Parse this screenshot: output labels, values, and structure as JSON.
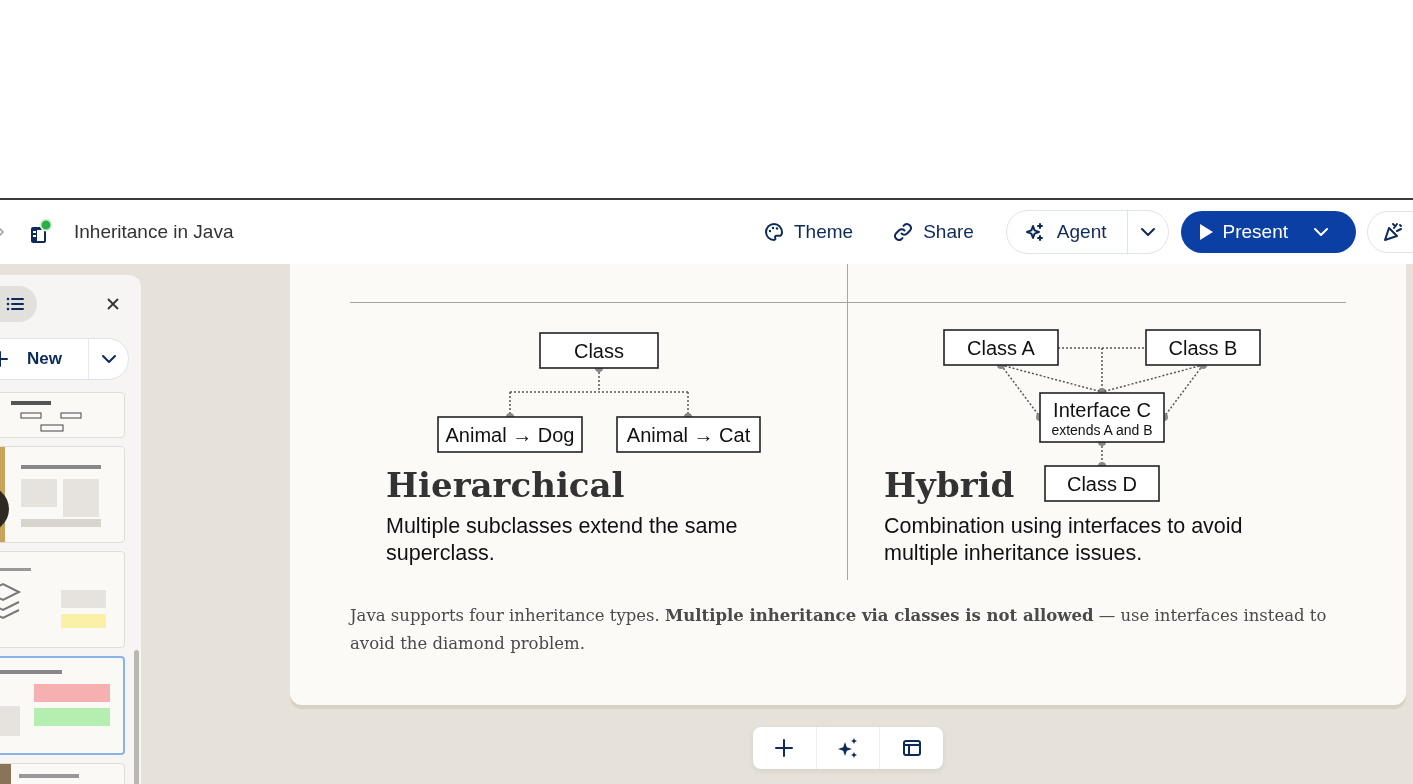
{
  "header": {
    "title": "Inheritance in Java",
    "actions": [
      {
        "kind": "theme",
        "label": "Theme"
      },
      {
        "kind": "share",
        "label": "Share"
      },
      {
        "kind": "agent",
        "label": "Agent"
      },
      {
        "kind": "present",
        "label": "Present"
      }
    ]
  },
  "sidebar": {
    "new_label": "New",
    "slides": [
      {
        "selected": false
      },
      {
        "selected": false
      },
      {
        "selected": false
      },
      {
        "selected": true
      },
      {
        "selected": false
      }
    ]
  },
  "slide": {
    "panels": [
      {
        "kind": "hierarchical",
        "title": "Hierarchical",
        "description": "Multiple subclasses extend the same superclass.",
        "nodes": [
          {
            "label": "Class"
          },
          {
            "label": "Animal → Dog"
          },
          {
            "label": "Animal → Cat"
          }
        ]
      },
      {
        "kind": "hybrid",
        "title": "Hybrid",
        "description": "Combination using interfaces to avoid multiple inheritance issues.",
        "nodes": [
          {
            "label": "Class A"
          },
          {
            "label": "Class B"
          },
          {
            "label": "Interface C",
            "note": "extends A and B"
          },
          {
            "label": "Class D"
          }
        ]
      }
    ],
    "footer": "Java supports four inheritance types. **Multiple inheritance via classes is not allowed** — use interfaces instead to avoid the diamond problem."
  }
}
